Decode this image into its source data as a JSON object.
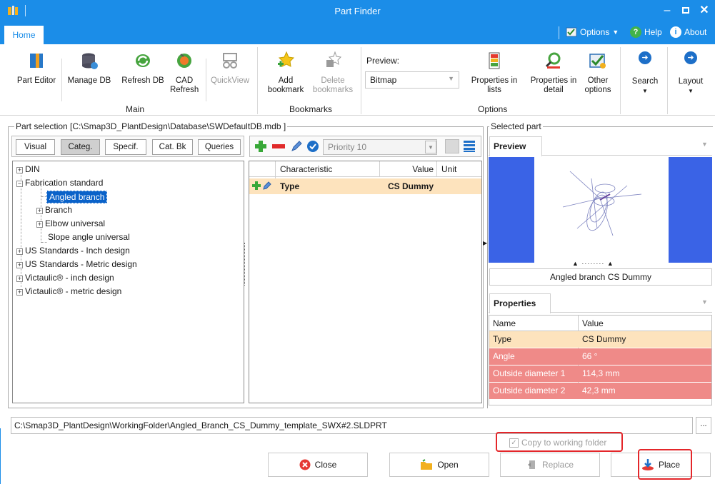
{
  "window": {
    "title": "Part Finder"
  },
  "tabs": {
    "home": "Home",
    "options": "Options",
    "help": "Help",
    "about": "About"
  },
  "ribbon": {
    "part_editor": "Part Editor",
    "manage_db": "Manage DB",
    "refresh_db": "Refresh DB",
    "cad_refresh_1": "CAD",
    "cad_refresh_2": "Refresh",
    "quickview": "QuickView",
    "group_main": "Main",
    "add_bookmark_1": "Add",
    "add_bookmark_2": "bookmark",
    "delete_bookmarks_1": "Delete",
    "delete_bookmarks_2": "bookmarks",
    "group_bookmarks": "Bookmarks",
    "preview_label": "Preview:",
    "preview_value": "Bitmap",
    "props_lists_1": "Properties in",
    "props_lists_2": "lists",
    "props_detail_1": "Properties in",
    "props_detail_2": "detail",
    "other_options_1": "Other",
    "other_options_2": "options",
    "group_options": "Options",
    "search": "Search",
    "layout": "Layout"
  },
  "part_selection": {
    "legend": "Part selection [C:\\Smap3D_PlantDesign\\Database\\SWDefaultDB.mdb ]",
    "tabs": [
      "Visual",
      "Categ.",
      "Specif.",
      "Cat. Bk",
      "Queries"
    ],
    "priority": "Priority 10",
    "tree": {
      "din": "DIN",
      "fabrication": "Fabrication standard",
      "angled_branch": "Angled branch",
      "branch": "Branch",
      "elbow": "Elbow universal",
      "slope": "Slope angle universal",
      "us_inch": "US Standards - Inch design",
      "us_metric": "US Standards - Metric design",
      "vic_inch": "Victaulic® - inch design",
      "vic_metric": "Victaulic® - metric design"
    },
    "grid": {
      "headers": {
        "characteristic": "Characteristic",
        "value": "Value",
        "unit": "Unit"
      },
      "row": {
        "characteristic": "Type",
        "value": "CS Dummy",
        "unit": ""
      }
    }
  },
  "selected_part": {
    "legend": "Selected part",
    "preview_tab": "Preview",
    "caption": "Angled branch CS Dummy",
    "properties_tab": "Properties",
    "headers": {
      "name": "Name",
      "value": "Value"
    },
    "rows": [
      {
        "name": "Type",
        "value": "CS Dummy",
        "color": "#fde3bd"
      },
      {
        "name": "Angle",
        "value": "66 °",
        "color": "#ef8a88"
      },
      {
        "name": "Outside diameter 1",
        "value": "114,3 mm",
        "color": "#ef8a88"
      },
      {
        "name": "Outside diameter 2",
        "value": "42,3 mm",
        "color": "#ef8a88"
      }
    ]
  },
  "path": {
    "value": "C:\\Smap3D_PlantDesign\\WorkingFolder\\Angled_Branch_CS_Dummy_template_SWX#2.SLDPRT",
    "browse": "..."
  },
  "copy_to_working": {
    "label": "Copy to working folder",
    "checked": true
  },
  "buttons": {
    "close": "Close",
    "open": "Open",
    "replace": "Replace",
    "place": "Place"
  },
  "colors": {
    "accent": "#1b8de8",
    "highlight_row": "#fde3bd",
    "error_row": "#ef8a88",
    "selection": "#0a62c9",
    "annotation": "#e4262a"
  }
}
